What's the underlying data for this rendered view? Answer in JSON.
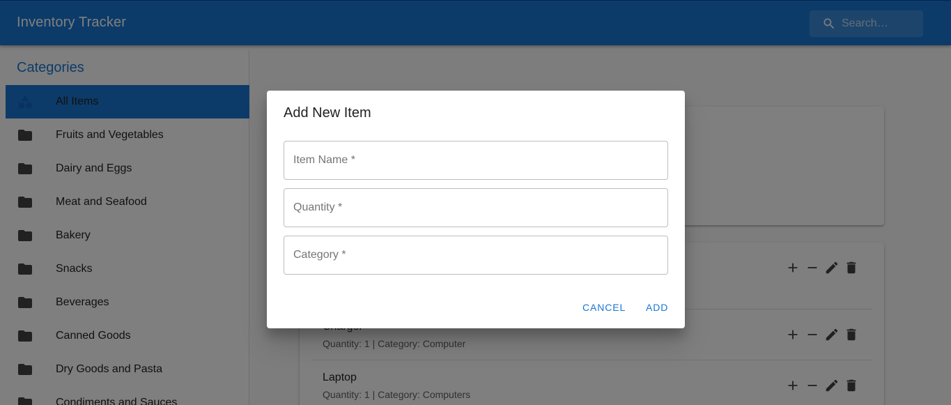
{
  "appbar": {
    "title": "Inventory Tracker",
    "search_placeholder": "Search…",
    "search_icon": "search-icon"
  },
  "sidebar": {
    "heading": "Categories",
    "items": [
      {
        "label": "All Items",
        "icon": "category-shapes-icon",
        "selected": true
      },
      {
        "label": "Fruits and Vegetables",
        "icon": "folder-icon"
      },
      {
        "label": "Dairy and Eggs",
        "icon": "folder-icon"
      },
      {
        "label": "Meat and Seafood",
        "icon": "folder-icon"
      },
      {
        "label": "Bakery",
        "icon": "folder-icon"
      },
      {
        "label": "Snacks",
        "icon": "folder-icon"
      },
      {
        "label": "Beverages",
        "icon": "folder-icon"
      },
      {
        "label": "Canned Goods",
        "icon": "folder-icon"
      },
      {
        "label": "Dry Goods and Pasta",
        "icon": "folder-icon"
      },
      {
        "label": "Condiments and Sauces",
        "icon": "folder-icon"
      }
    ]
  },
  "items": [
    {
      "name": "",
      "details": ""
    },
    {
      "name": "Charger",
      "details": "Quantity: 1 | Category: Computer"
    },
    {
      "name": "Laptop",
      "details": "Quantity: 1 | Category: Computers"
    }
  ],
  "dialog": {
    "title": "Add New Item",
    "fields": {
      "name_placeholder": "Item Name *",
      "quantity_placeholder": "Quantity *",
      "category_placeholder": "Category *"
    },
    "cancel_label": "CANCEL",
    "add_label": "ADD"
  },
  "colors": {
    "primary": "#1976d2",
    "overlay": "rgba(0,0,0,0.5)"
  }
}
